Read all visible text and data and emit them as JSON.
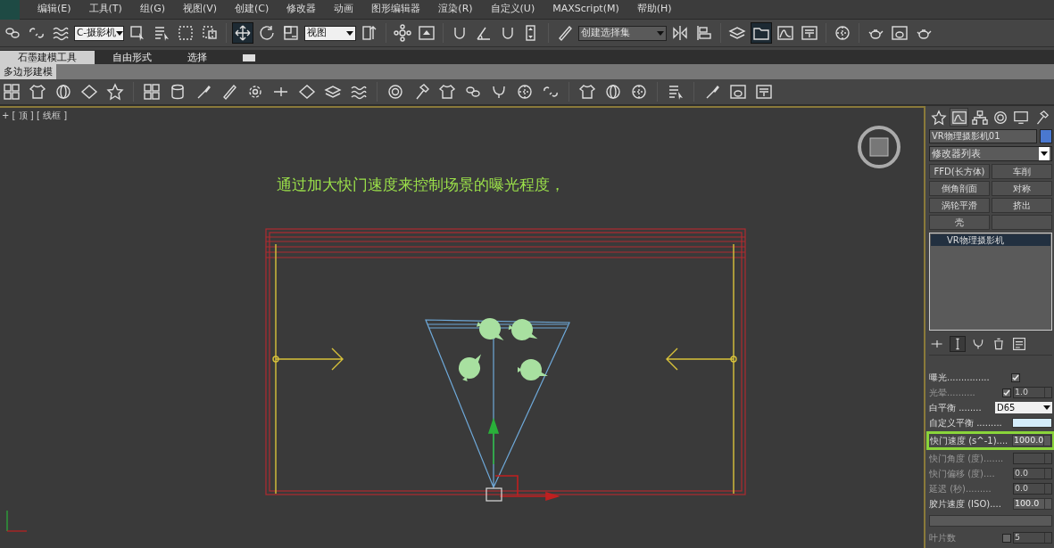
{
  "menu_bar": {
    "items": [
      "编辑(E)",
      "工具(T)",
      "组(G)",
      "视图(V)",
      "创建(C)",
      "修改器",
      "动画",
      "图形编辑器",
      "渲染(R)",
      "自定义(U)",
      "MAXScript(M)",
      "帮助(H)"
    ]
  },
  "main_toolbar": [
    {
      "kind": "button",
      "selected": false
    },
    {
      "kind": "button",
      "selected": false
    },
    {
      "kind": "button",
      "selected": false
    },
    {
      "kind": "dropdown",
      "value": "C-摄影机"
    },
    {
      "kind": "button",
      "selected": false
    },
    {
      "kind": "button",
      "selected": false
    },
    {
      "kind": "button",
      "selected": false
    },
    {
      "kind": "button",
      "selected": false
    },
    {
      "kind": "separator"
    },
    {
      "kind": "button",
      "selected": true
    },
    {
      "kind": "button",
      "selected": false
    },
    {
      "kind": "button",
      "selected": false
    },
    {
      "kind": "dropdown",
      "value": "视图"
    },
    {
      "kind": "button",
      "selected": false
    },
    {
      "kind": "separator"
    },
    {
      "kind": "button",
      "selected": false
    },
    {
      "kind": "button",
      "selected": false
    },
    {
      "kind": "separator"
    },
    {
      "kind": "button",
      "selected": false
    },
    {
      "kind": "button",
      "selected": false
    },
    {
      "kind": "button",
      "selected": false
    },
    {
      "kind": "button",
      "selected": false
    },
    {
      "kind": "separator"
    },
    {
      "kind": "button",
      "selected": false
    },
    {
      "kind": "dropdown",
      "value": "创建选择集"
    },
    {
      "kind": "button",
      "selected": false
    },
    {
      "kind": "button",
      "selected": false
    },
    {
      "kind": "separator"
    },
    {
      "kind": "button",
      "selected": false
    },
    {
      "kind": "button",
      "selected": true
    },
    {
      "kind": "button",
      "selected": false
    },
    {
      "kind": "button",
      "selected": false
    },
    {
      "kind": "separator"
    },
    {
      "kind": "button",
      "selected": false
    },
    {
      "kind": "separator"
    },
    {
      "kind": "button",
      "selected": false
    },
    {
      "kind": "button",
      "selected": false
    },
    {
      "kind": "button",
      "selected": false
    }
  ],
  "ribbon": {
    "tabs": [
      {
        "label": "石墨建模工具",
        "selected": true
      },
      {
        "label": "自由形式",
        "selected": false
      },
      {
        "label": "选择",
        "selected": false
      }
    ],
    "panel_tab": "多边形建模"
  },
  "viewport": {
    "label": "+ [ 顶 ] [ 线框 ]",
    "annotation": "通过加大快门速度来控制场景的曝光程度，"
  },
  "command_panel": {
    "tabs": [
      {
        "selected": false
      },
      {
        "selected": true
      },
      {
        "selected": false
      },
      {
        "selected": false
      },
      {
        "selected": false
      },
      {
        "selected": false
      }
    ],
    "object_name": "VR物理摄影机01",
    "object_swatch": {
      "color": "#4a78d0"
    },
    "modifier_list": "修改器列表",
    "modifier_buttons": [
      "FFD(长方体)",
      "车削",
      "倒角剖面",
      "对称",
      "涡轮平滑",
      "挤出",
      "壳"
    ],
    "stack": [
      {
        "label": "VR物理摄影机",
        "selected": true
      }
    ],
    "stack_tools": [
      {
        "selected": false
      },
      {
        "selected": true
      },
      {
        "selected": false
      },
      {
        "selected": false
      },
      {
        "selected": false
      }
    ],
    "parameters": [
      {
        "kind": "checkbox",
        "label": "曝光...............",
        "checked": true
      },
      {
        "kind": "checkbox_spinner",
        "label": "光晕..........",
        "checked": true,
        "value": "1.0",
        "disabled": true
      },
      {
        "kind": "dropdown",
        "label": "白平衡 ........",
        "value": "D65"
      },
      {
        "kind": "color",
        "label": "自定义平衡 .........",
        "color": "#d4ecfb"
      },
      {
        "kind": "spinner",
        "label": "快门速度 (s^-1)....",
        "value": "1000.0",
        "disabled": false,
        "highlighted": true
      },
      {
        "kind": "spinner",
        "label": "快门角度 (度).......",
        "disabled": true,
        "highlighted": false
      },
      {
        "kind": "spinner",
        "label": "快门偏移 (度)....",
        "value": "0.0",
        "disabled": true,
        "highlighted": false
      },
      {
        "kind": "spinner",
        "label": "延迟 (秒).........",
        "value": "0.0",
        "disabled": true,
        "highlighted": false
      },
      {
        "kind": "spinner",
        "label": "胶片速度 (ISO)....",
        "value": "100.0",
        "disabled": false,
        "highlighted": false
      },
      {
        "kind": "rollout"
      },
      {
        "kind": "checkbox_spinner",
        "label": "叶片数",
        "checked": false,
        "value": "5",
        "disabled": true
      }
    ]
  }
}
